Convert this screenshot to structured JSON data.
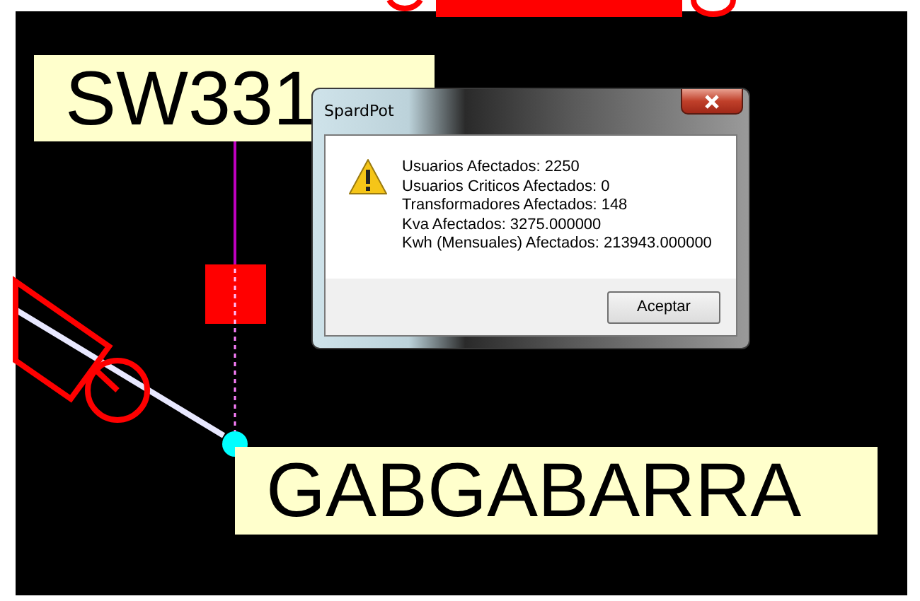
{
  "canvas": {
    "labels": [
      {
        "text": "SW331"
      },
      {
        "text": "GABGABARRA"
      }
    ]
  },
  "dialog": {
    "title": "SpardPot",
    "lines": [
      "Usuarios Afectados: 2250",
      "Usuarios Criticos Afectados: 0",
      "Transformadores Afectados: 148",
      "Kva Afectados: 3275.000000",
      "Kwh (Mensuales) Afectados: 213943.000000"
    ],
    "buttons": [
      "Aceptar"
    ]
  }
}
